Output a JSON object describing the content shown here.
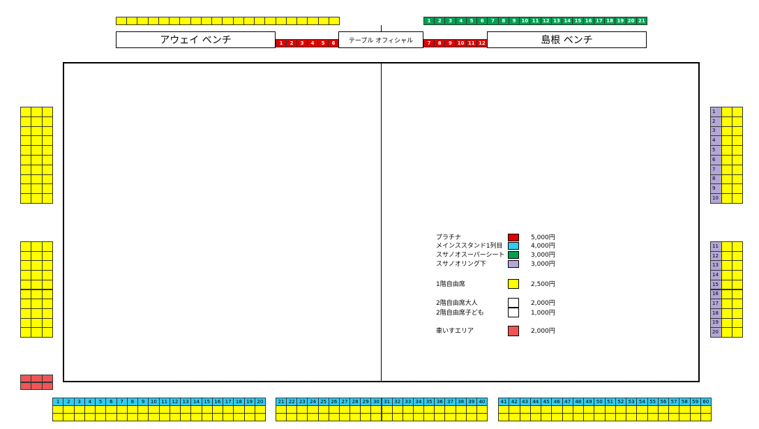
{
  "benches": {
    "away_label": "アウェイ ベンチ",
    "table_label": "テーブル オフィシャル",
    "home_label": "島根 ベンチ"
  },
  "platinum": {
    "left_numbers": [
      "1",
      "2",
      "3",
      "4",
      "5",
      "6"
    ],
    "right_numbers": [
      "7",
      "8",
      "9",
      "10",
      "11",
      "12"
    ]
  },
  "green_row": {
    "numbers": [
      "1",
      "2",
      "3",
      "4",
      "5",
      "6",
      "7",
      "8",
      "9",
      "10",
      "11",
      "12",
      "13",
      "14",
      "15",
      "16",
      "17",
      "18",
      "19",
      "20",
      "21"
    ]
  },
  "lavender_col": {
    "upper": [
      "1",
      "2",
      "3",
      "4",
      "5",
      "6",
      "7",
      "8",
      "9",
      "10"
    ],
    "lower": [
      "11",
      "12",
      "13",
      "14",
      "15",
      "16",
      "17",
      "18",
      "19",
      "20"
    ]
  },
  "blue_row": {
    "block1": [
      "1",
      "2",
      "3",
      "4",
      "5",
      "6",
      "7",
      "8",
      "9",
      "10",
      "11",
      "12",
      "13",
      "14",
      "15",
      "16",
      "17",
      "18",
      "19",
      "20"
    ],
    "block2": [
      "21",
      "22",
      "23",
      "24",
      "25",
      "26",
      "27",
      "28",
      "29",
      "30",
      "31",
      "32",
      "33",
      "34",
      "35",
      "36",
      "37",
      "38",
      "39",
      "40"
    ],
    "block3": [
      "41",
      "42",
      "43",
      "44",
      "45",
      "46",
      "47",
      "48",
      "49",
      "50",
      "51",
      "52",
      "53",
      "54",
      "55",
      "56",
      "57",
      "58",
      "59",
      "60"
    ]
  },
  "legend": {
    "items": [
      {
        "label": "プラチナ",
        "price": "5,000円",
        "color": "#E00000"
      },
      {
        "label": "メインススタンド1列目",
        "price": "4,000円",
        "color": "#33CCEE"
      },
      {
        "label": "スサノオスーパーシート",
        "price": "3,000円",
        "color": "#00A050"
      },
      {
        "label": "スサノオリング下",
        "price": "3,000円",
        "color": "#B4A7D6"
      },
      {
        "label": "1階自由席",
        "price": "2,500円",
        "color": "#FFFF00"
      },
      {
        "label": "2階自由席大人",
        "price": "2,000円",
        "color": "#FFFFFF"
      },
      {
        "label": "2階自由席子ども",
        "price": "1,000円",
        "color": "#FFFFFF"
      },
      {
        "label": "車いすエリア",
        "price": "2,000円",
        "color": "#EE5555"
      }
    ]
  }
}
